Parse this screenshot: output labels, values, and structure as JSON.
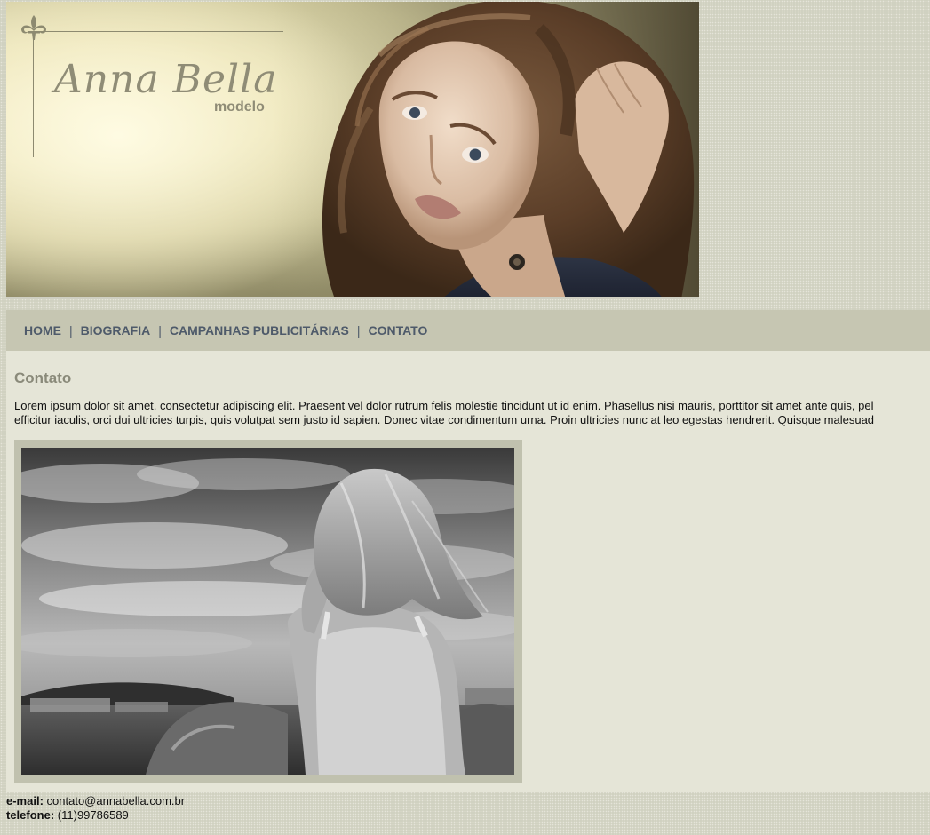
{
  "banner": {
    "logo_name": "Anna Bella",
    "logo_subtitle": "modelo"
  },
  "nav": {
    "items": [
      {
        "label": "HOME"
      },
      {
        "label": "BIOGRAFIA"
      },
      {
        "label": "CAMPANHAS PUBLICITÁRIAS"
      },
      {
        "label": "CONTATO"
      }
    ],
    "separator": "|"
  },
  "content": {
    "title": "Contato",
    "paragraph_line1": "Lorem ipsum dolor sit amet, consectetur adipiscing elit. Praesent vel dolor rutrum felis molestie tincidunt ut id enim. Phasellus nisi mauris, porttitor sit amet ante quis, pel",
    "paragraph_line2": "efficitur iaculis, orci dui ultricies turpis, quis volutpat sem justo id sapien. Donec vitae condimentum urna. Proin ultricies nunc at leo egestas hendrerit. Quisque malesuad"
  },
  "footer": {
    "email_label": "e-mail:",
    "email_value": "contato@annabella.com.br",
    "phone_label": "telefone:",
    "phone_value": "(11)99786589"
  },
  "colors": {
    "nav_bg": "#c6c6b2",
    "nav_text": "#4e5a6a",
    "content_bg": "#e5e5d7",
    "title_text": "#8a8a7a",
    "page_bg": "#d5d6c6"
  },
  "icons": {
    "logo_ornament": "fleur-de-lis-icon"
  }
}
